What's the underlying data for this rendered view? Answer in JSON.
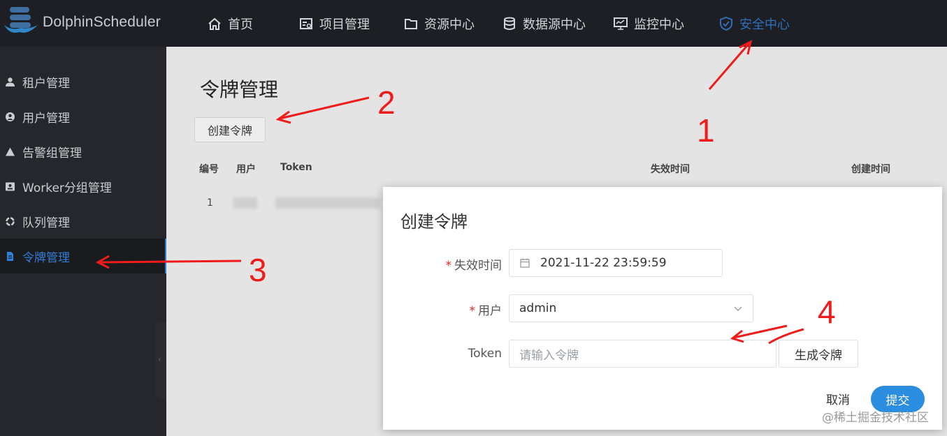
{
  "app": {
    "name": "DolphinScheduler"
  },
  "nav": {
    "items": [
      {
        "label": "首页",
        "icon": "home-icon"
      },
      {
        "label": "项目管理",
        "icon": "project-icon"
      },
      {
        "label": "资源中心",
        "icon": "folder-icon"
      },
      {
        "label": "数据源中心",
        "icon": "database-icon"
      },
      {
        "label": "监控中心",
        "icon": "monitor-icon"
      },
      {
        "label": "安全中心",
        "icon": "shield-icon",
        "active": true
      }
    ]
  },
  "sidebar": {
    "items": [
      {
        "label": "租户管理",
        "icon": "user-icon"
      },
      {
        "label": "用户管理",
        "icon": "user-circle-icon"
      },
      {
        "label": "告警组管理",
        "icon": "warning-icon"
      },
      {
        "label": "Worker分组管理",
        "icon": "id-card-icon"
      },
      {
        "label": "队列管理",
        "icon": "recycle-icon"
      },
      {
        "label": "令牌管理",
        "icon": "document-icon",
        "active": true
      }
    ]
  },
  "main": {
    "title": "令牌管理",
    "create_button": "创建令牌",
    "table": {
      "headers": [
        "编号",
        "用户",
        "Token",
        "失效时间",
        "创建时间"
      ],
      "rows": [
        {
          "id": "1"
        }
      ]
    }
  },
  "modal": {
    "title": "创建令牌",
    "expire_label": "失效时间",
    "expire_value": "2021-11-22 23:59:59",
    "user_label": "用户",
    "user_value": "admin",
    "token_label": "Token",
    "token_placeholder": "请输入令牌",
    "generate_button": "生成令牌",
    "cancel_button": "取消",
    "submit_button": "提交"
  },
  "annotations": {
    "n1": "1",
    "n2": "2",
    "n3": "3",
    "n4": "4"
  },
  "watermark": "@稀土掘金技术社区",
  "colors": {
    "accent": "#2a8de0",
    "active_nav": "#2e6fb7",
    "annotation": "#f01b1b",
    "topbar": "#1d1f24",
    "sidebar": "#25272c"
  }
}
